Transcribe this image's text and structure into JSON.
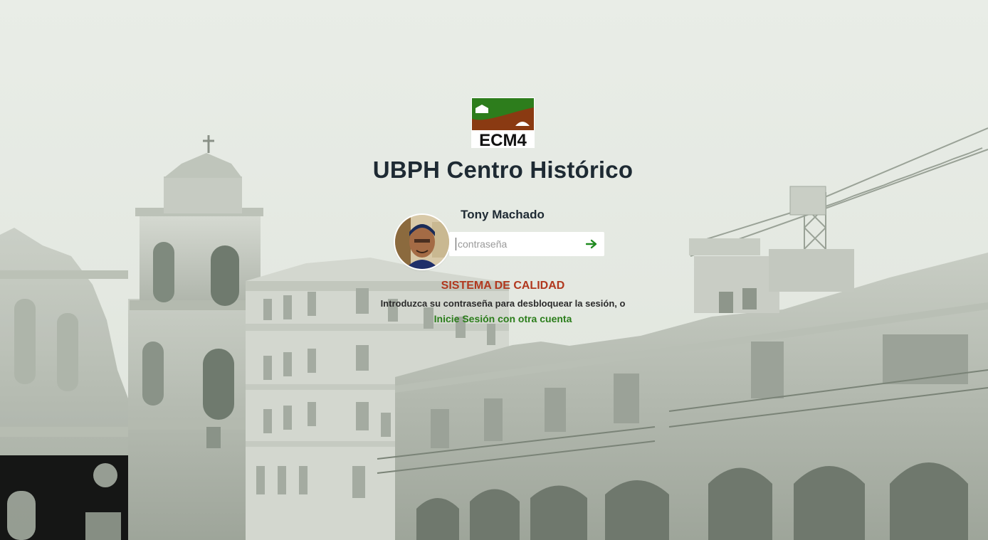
{
  "logo": {
    "text": "ECM4",
    "colors": {
      "green": "#2d7d1c",
      "brown": "#8a3a12",
      "white": "#ffffff"
    }
  },
  "app_title": "UBPH Centro Histórico",
  "user": {
    "name": "Tony Machado"
  },
  "password": {
    "placeholder": "contraseña",
    "value": ""
  },
  "submit_icon": "arrow-right-icon",
  "system_title": "SISTEMA DE CALIDAD",
  "unlock_text": "Introduzca su contraseña para desbloquear la sesión, o",
  "other_account_link": "Inicie Sesión con otra cuenta",
  "colors": {
    "title": "#1e2a33",
    "accent_red": "#b1381e",
    "accent_green": "#2a7d1a"
  }
}
